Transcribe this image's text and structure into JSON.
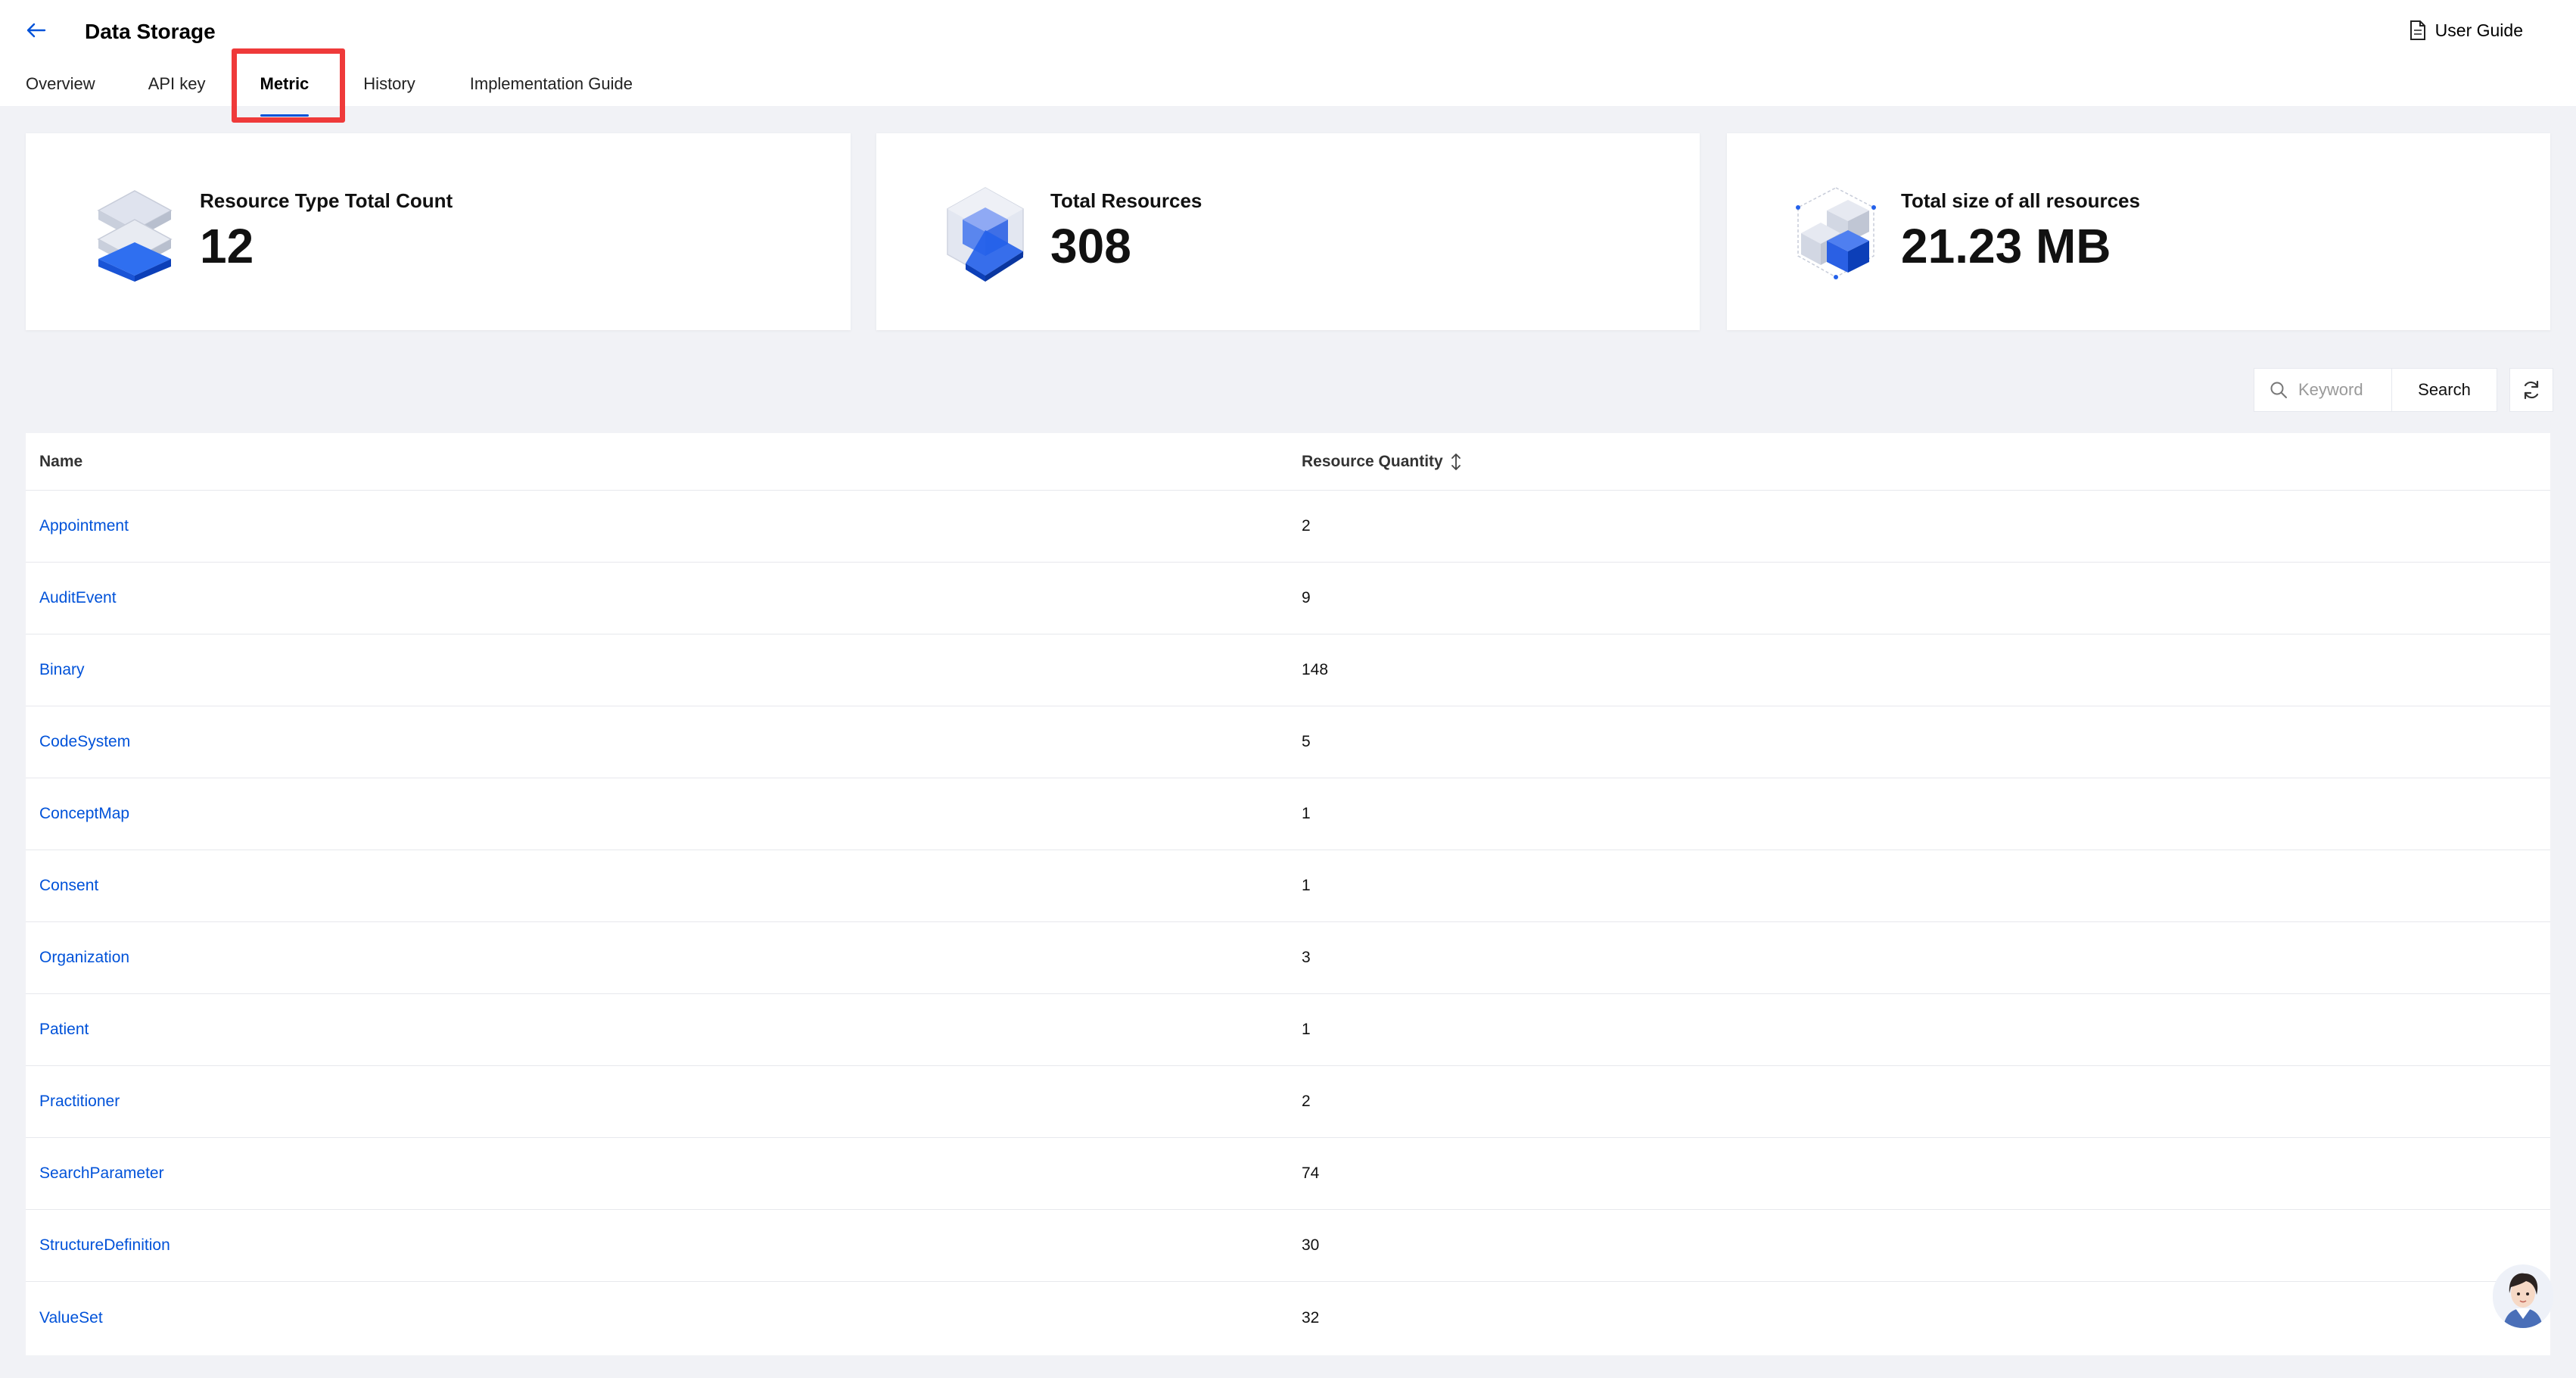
{
  "header": {
    "title": "Data Storage",
    "user_guide_label": "User Guide"
  },
  "tabs": [
    {
      "label": "Overview"
    },
    {
      "label": "API key"
    },
    {
      "label": "Metric"
    },
    {
      "label": "History"
    },
    {
      "label": "Implementation Guide"
    }
  ],
  "active_tab": "Metric",
  "stats": [
    {
      "label": "Resource Type Total Count",
      "value": "12",
      "icon": "layers-icon"
    },
    {
      "label": "Total Resources",
      "value": "308",
      "icon": "cube-icon"
    },
    {
      "label": "Total size of all resources",
      "value": "21.23 MB",
      "icon": "blocks-icon"
    }
  ],
  "search": {
    "placeholder": "Keyword",
    "button_label": "Search"
  },
  "table": {
    "columns": [
      "Name",
      "Resource Quantity"
    ],
    "rows": [
      {
        "name": "Appointment",
        "qty": "2"
      },
      {
        "name": "AuditEvent",
        "qty": "9"
      },
      {
        "name": "Binary",
        "qty": "148"
      },
      {
        "name": "CodeSystem",
        "qty": "5"
      },
      {
        "name": "ConceptMap",
        "qty": "1"
      },
      {
        "name": "Consent",
        "qty": "1"
      },
      {
        "name": "Organization",
        "qty": "3"
      },
      {
        "name": "Patient",
        "qty": "1"
      },
      {
        "name": "Practitioner",
        "qty": "2"
      },
      {
        "name": "SearchParameter",
        "qty": "74"
      },
      {
        "name": "StructureDefinition",
        "qty": "30"
      },
      {
        "name": "ValueSet",
        "qty": "32"
      }
    ]
  },
  "colors": {
    "accent": "#0052d9",
    "highlight": "#ef3a3a",
    "background": "#f1f2f6"
  }
}
